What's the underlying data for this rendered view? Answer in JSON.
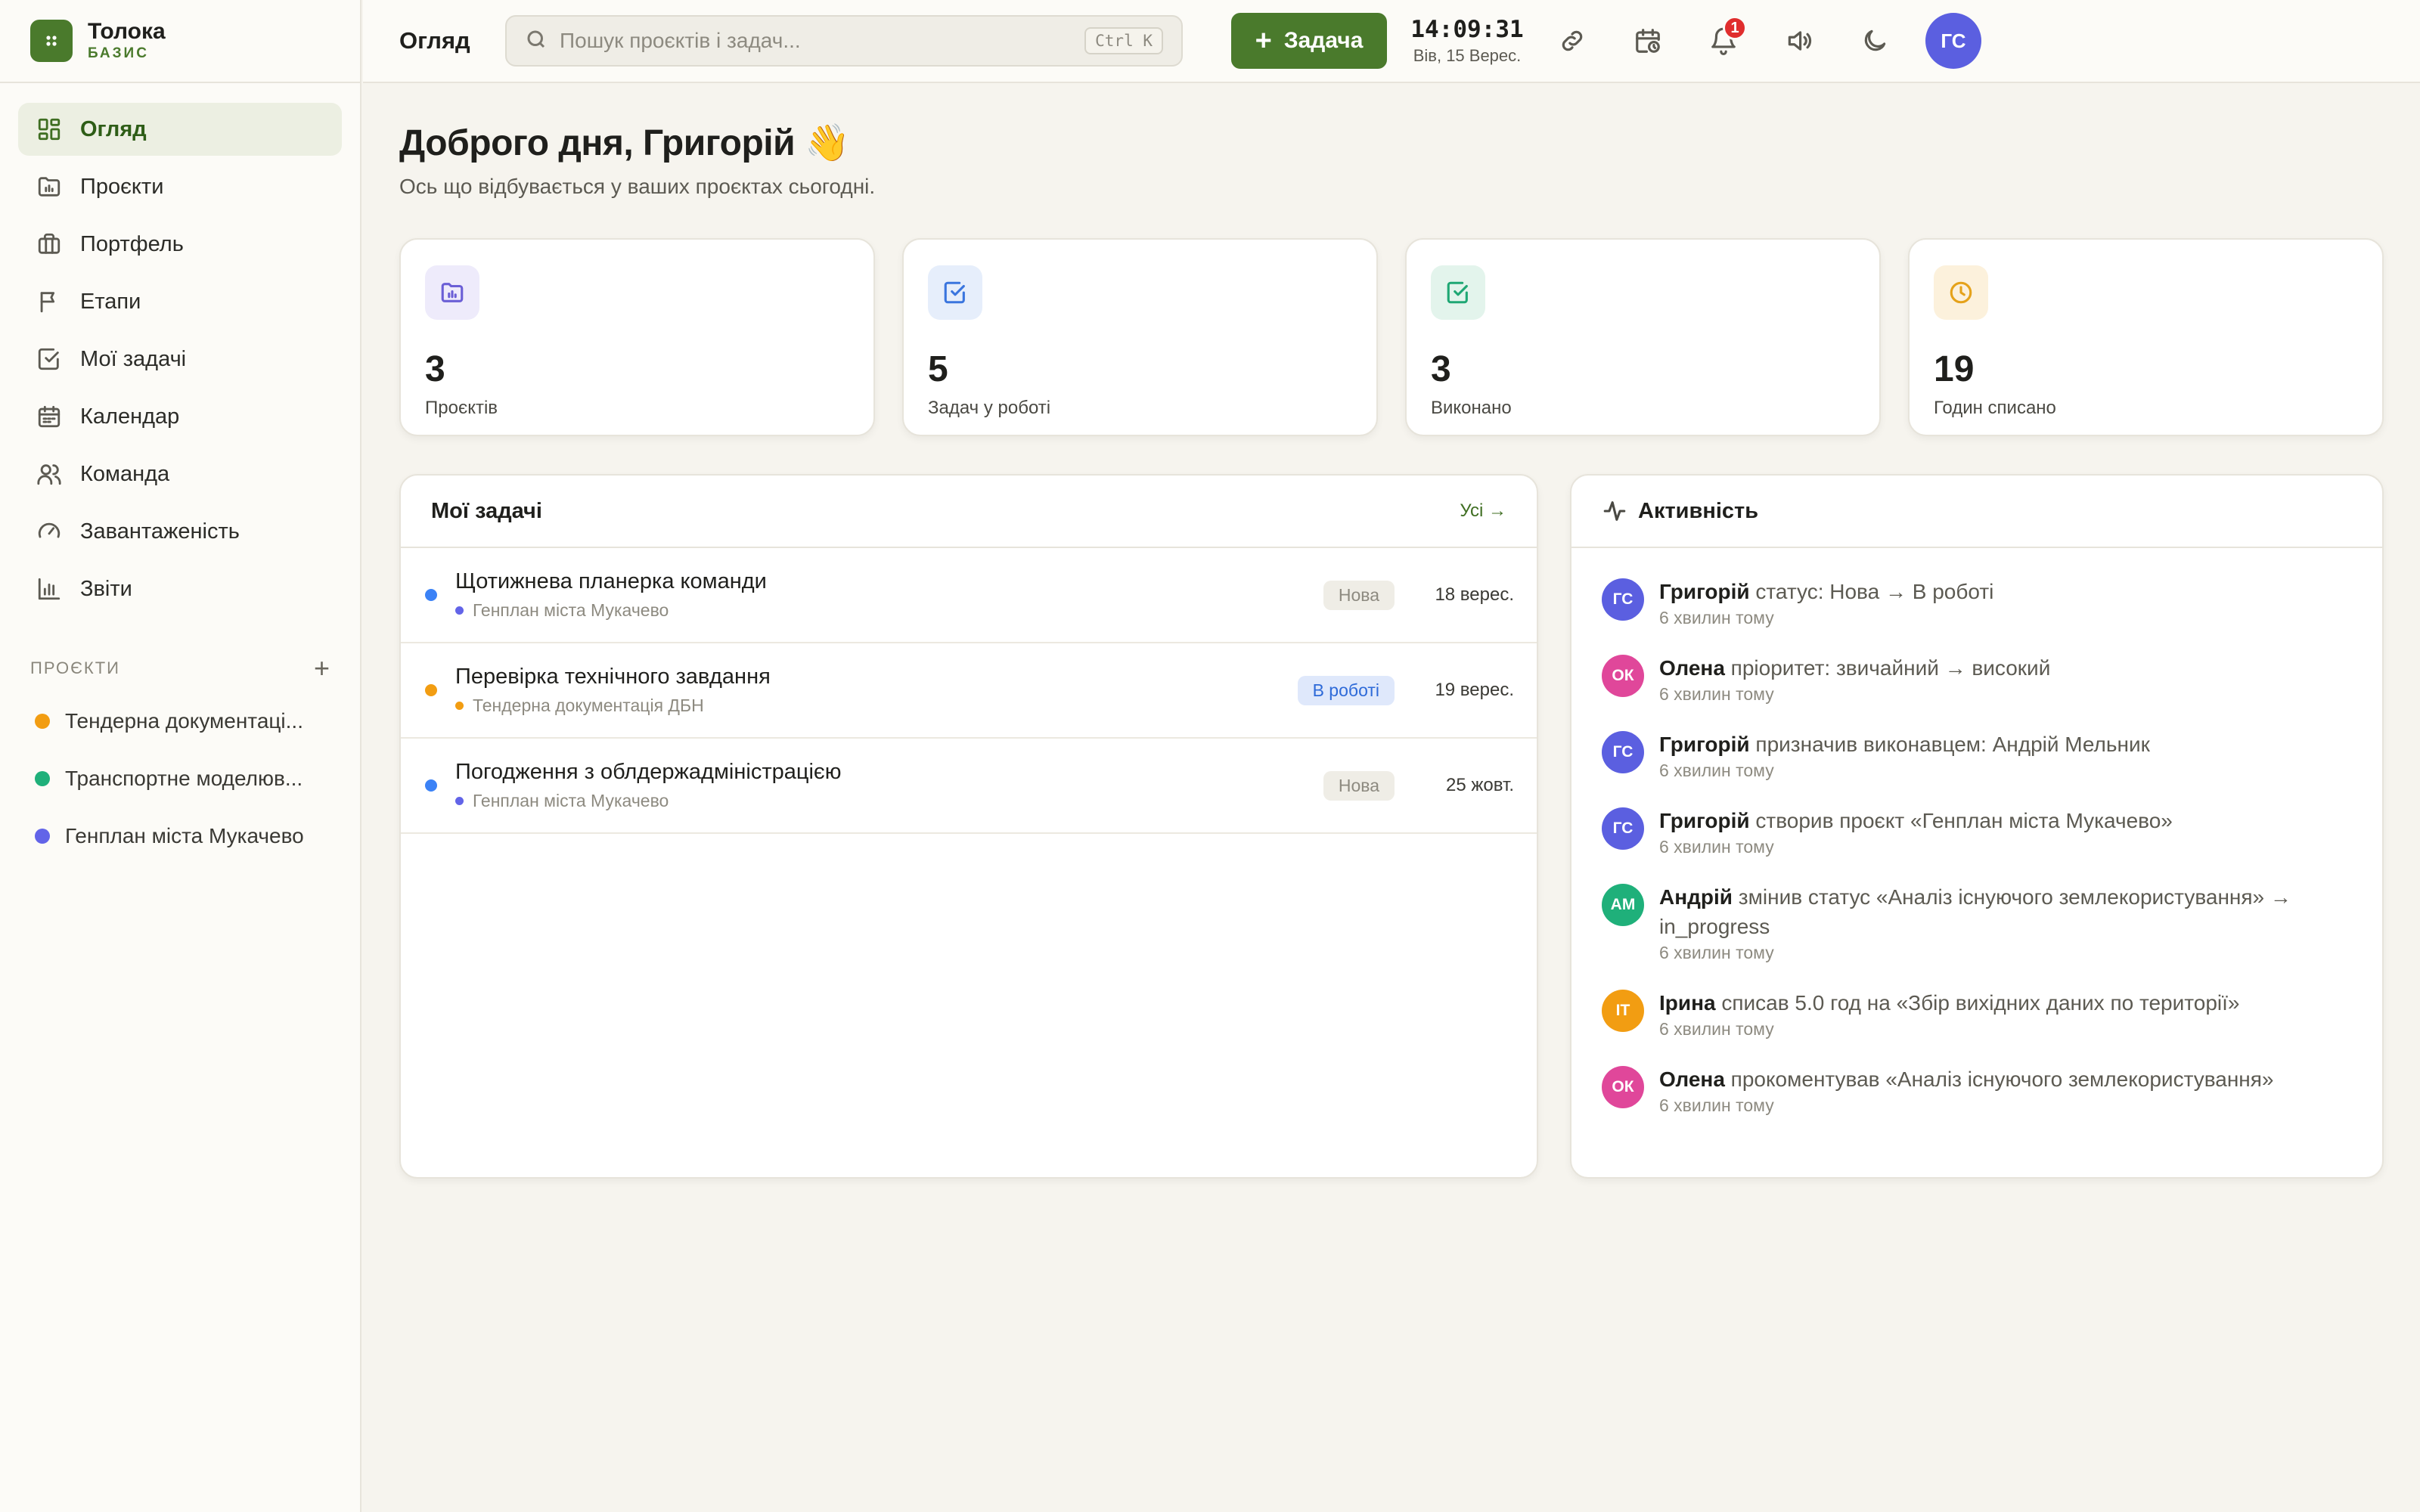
{
  "brand": {
    "name": "Толока",
    "sub": "БАЗИС",
    "accent": "#4a7a2c"
  },
  "sidebar": {
    "items": [
      {
        "label": "Огляд",
        "icon": "dashboard-grid-icon",
        "active": true
      },
      {
        "label": "Проєкти",
        "icon": "folder-chart-icon"
      },
      {
        "label": "Портфель",
        "icon": "briefcase-icon"
      },
      {
        "label": "Етапи",
        "icon": "flag-icon"
      },
      {
        "label": "Мої задачі",
        "icon": "checkbox-icon"
      },
      {
        "label": "Календар",
        "icon": "calendar-icon"
      },
      {
        "label": "Команда",
        "icon": "users-icon"
      },
      {
        "label": "Завантаженість",
        "icon": "gauge-icon"
      },
      {
        "label": "Звіти",
        "icon": "bar-chart-icon"
      }
    ],
    "projects_heading": "ПРОЄКТИ",
    "projects": [
      {
        "label": "Тендерна документаці...",
        "color": "#f29d12"
      },
      {
        "label": "Транспортне моделюв...",
        "color": "#1fb07a"
      },
      {
        "label": "Генплан міста Мукачево",
        "color": "#6264e8"
      }
    ]
  },
  "topbar": {
    "title": "Огляд",
    "search_placeholder": "Пошук проєктів і задач...",
    "search_shortcut": "Ctrl K",
    "add_button": "Задача",
    "time": "14:09:31",
    "date": "Вів, 15 Верес.",
    "notifications_count": "1",
    "avatar_initials": "ГС"
  },
  "main": {
    "greeting": "Доброго дня, Григорій 👋",
    "subtitle": "Ось що відбувається у ваших проєктах сьогодні.",
    "stats": [
      {
        "value": "3",
        "label": "Проєктів",
        "icon": "folder-chart-icon",
        "color": "#6b5fd6",
        "bg": "#eeebfb"
      },
      {
        "value": "5",
        "label": "Задач у роботі",
        "icon": "checkbox-icon",
        "color": "#3a75de",
        "bg": "#e6eefb"
      },
      {
        "value": "3",
        "label": "Виконано",
        "icon": "checkbox-icon",
        "color": "#1fa774",
        "bg": "#e3f4ec"
      },
      {
        "value": "19",
        "label": "Годин списано",
        "icon": "clock-icon",
        "color": "#e5a21a",
        "bg": "#fcf1dc"
      }
    ],
    "tasks_panel": {
      "title": "Мої задачі",
      "link": "Усі →",
      "rows": [
        {
          "title": "Щотижнева планерка команди",
          "project": "Генплан міста Мукачево",
          "dot": "#3b82f6",
          "project_dot": "#6264e8",
          "status": "Нова",
          "status_kind": "new",
          "date": "18 верес."
        },
        {
          "title": "Перевірка технічного завдання",
          "project": "Тендерна документація ДБН",
          "dot": "#f29d12",
          "project_dot": "#f29d12",
          "status": "В роботі",
          "status_kind": "progress",
          "date": "19 верес."
        },
        {
          "title": "Погодження з облдержадміністрацією",
          "project": "Генплан міста Мукачево",
          "dot": "#3b82f6",
          "project_dot": "#6264e8",
          "status": "Нова",
          "status_kind": "new",
          "date": "25 жовт."
        }
      ]
    },
    "activity_panel": {
      "title": "Активність",
      "items": [
        {
          "initials": "ГС",
          "color": "#5b5fe0",
          "who": "Григорій",
          "text": "статус: Нова → В роботі",
          "time": "6 хвилин тому"
        },
        {
          "initials": "ОК",
          "color": "#e0479a",
          "who": "Олена",
          "text": "пріоритет: звичайний → високий",
          "time": "6 хвилин тому"
        },
        {
          "initials": "ГС",
          "color": "#5b5fe0",
          "who": "Григорій",
          "text": "призначив виконавцем: Андрій Мельник",
          "time": "6 хвилин тому"
        },
        {
          "initials": "ГС",
          "color": "#5b5fe0",
          "who": "Григорій",
          "text": "створив проєкт «Генплан міста Мукачево»",
          "time": "6 хвилин тому"
        },
        {
          "initials": "АМ",
          "color": "#1fb07a",
          "who": "Андрій",
          "text": "змінив статус «Аналіз існуючого землекористування» → in_progress",
          "time": "6 хвилин тому"
        },
        {
          "initials": "ІТ",
          "color": "#f29d12",
          "who": "Ірина",
          "text": "списав 5.0 год на «Збір вихідних даних по території»",
          "time": "6 хвилин тому"
        },
        {
          "initials": "ОК",
          "color": "#e0479a",
          "who": "Олена",
          "text": "прокоментував «Аналіз існуючого землекористування»",
          "time": "6 хвилин тому"
        }
      ]
    }
  }
}
